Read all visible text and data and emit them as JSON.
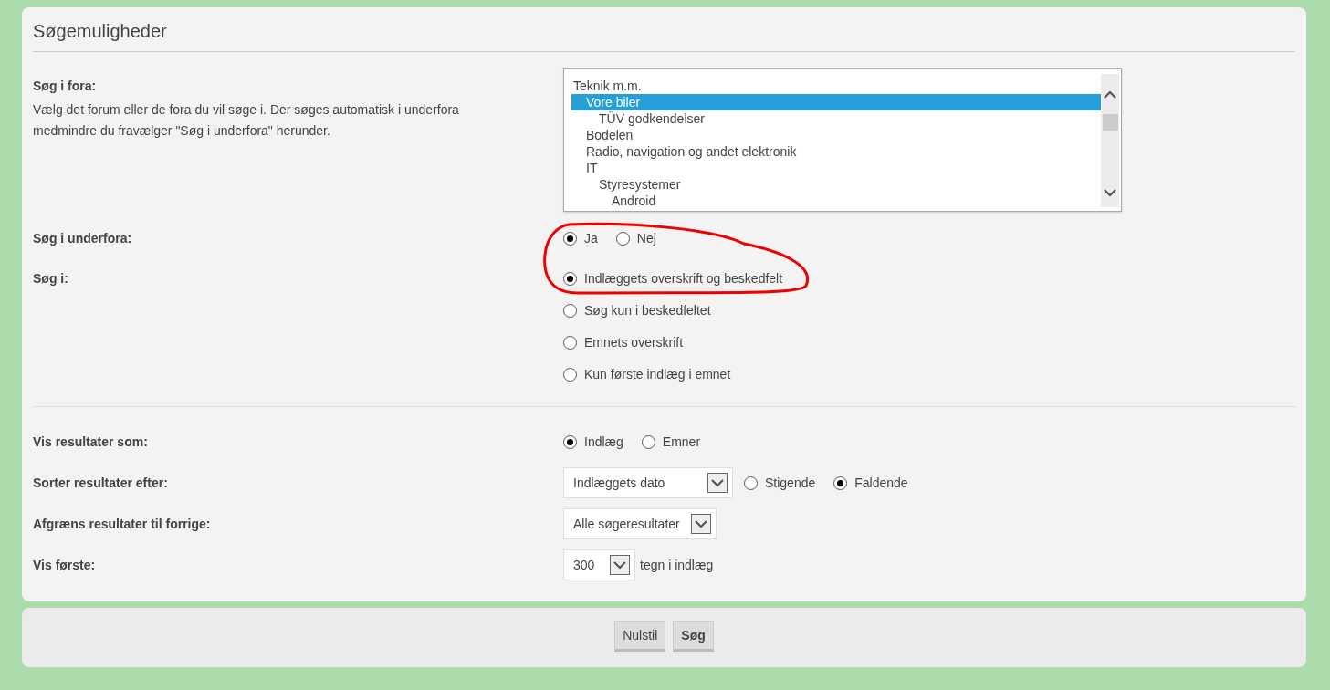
{
  "title": "Søgemuligheder",
  "forum_select": {
    "label": "Søg i fora:",
    "description": "Vælg det forum eller de fora du vil søge i. Der søges automatisk i underfora medmindre du fravælger \"Søg i underfora\" herunder.",
    "items": [
      {
        "label": "Teknik m.m.",
        "selected": false,
        "children": [
          {
            "label": "Vore biler",
            "selected": true,
            "children": [
              {
                "label": "TÜV godkendelser",
                "selected": false
              }
            ]
          },
          {
            "label": "Bodelen",
            "selected": false
          },
          {
            "label": "Radio, navigation og andet elektronik",
            "selected": false
          },
          {
            "label": "IT",
            "selected": false,
            "children": [
              {
                "label": "Styresystemer",
                "selected": false,
                "children": [
                  {
                    "label": "Android",
                    "selected": false
                  }
                ]
              }
            ]
          }
        ]
      }
    ]
  },
  "subforums": {
    "label": "Søg i underfora:",
    "options": [
      {
        "label": "Ja",
        "selected": true
      },
      {
        "label": "Nej",
        "selected": false
      }
    ]
  },
  "search_in": {
    "label": "Søg i:",
    "options": [
      {
        "label": "Indlæggets overskrift og beskedfelt",
        "selected": true
      },
      {
        "label": "Søg kun i beskedfeltet",
        "selected": false
      },
      {
        "label": "Emnets overskrift",
        "selected": false
      },
      {
        "label": "Kun første indlæg i emnet",
        "selected": false
      }
    ]
  },
  "display": {
    "label": "Vis resultater som:",
    "options": [
      {
        "label": "Indlæg",
        "selected": true
      },
      {
        "label": "Emner",
        "selected": false
      }
    ]
  },
  "sort": {
    "label": "Sorter resultater efter:",
    "value": "Indlæggets dato",
    "options": [
      {
        "label": "Stigende",
        "selected": false
      },
      {
        "label": "Faldende",
        "selected": true
      }
    ]
  },
  "limit": {
    "label": "Afgræns resultater til forrige:",
    "value": "Alle søgeresultater"
  },
  "show_first": {
    "label": "Vis første:",
    "value": "300",
    "suffix": "tegn i indlæg"
  },
  "buttons": [
    {
      "label": "Nulstil",
      "kind": "normal"
    },
    {
      "label": "Søg",
      "kind": "primary"
    }
  ]
}
